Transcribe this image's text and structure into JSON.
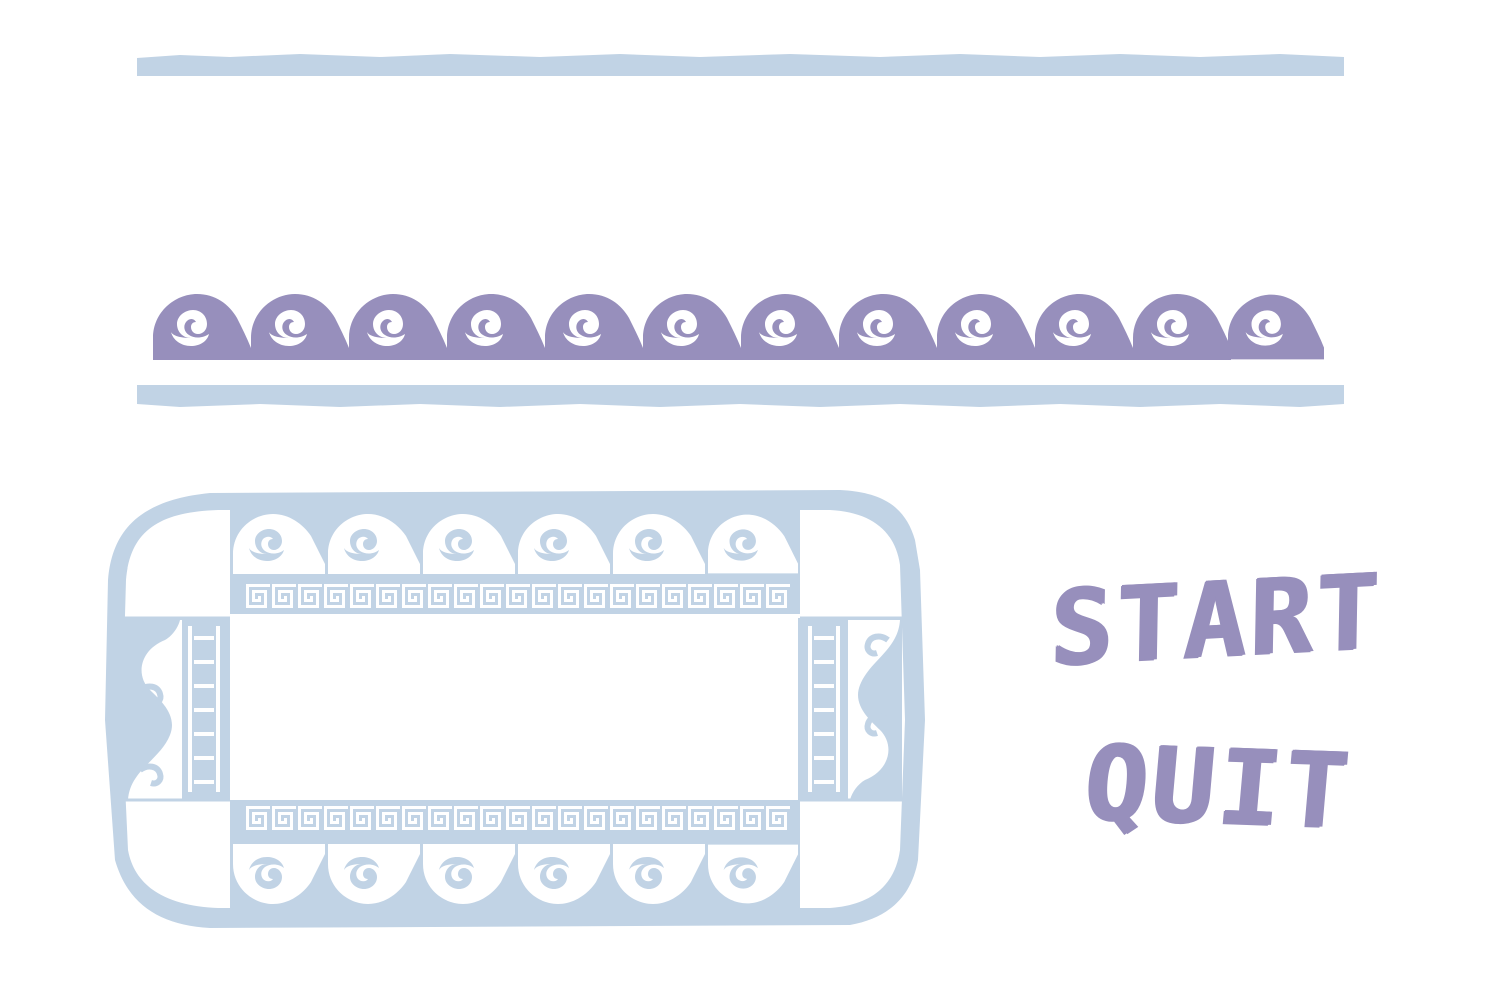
{
  "menu": {
    "start_label": "START",
    "quit_label": "QUIT"
  },
  "theme": {
    "light_blue": "#c1d3e5",
    "lavender": "#978fbc",
    "background": "#ffffff"
  },
  "decor": {
    "top_wave_border": "greek-wave-border",
    "panel_frame": "greek-key-frame"
  }
}
